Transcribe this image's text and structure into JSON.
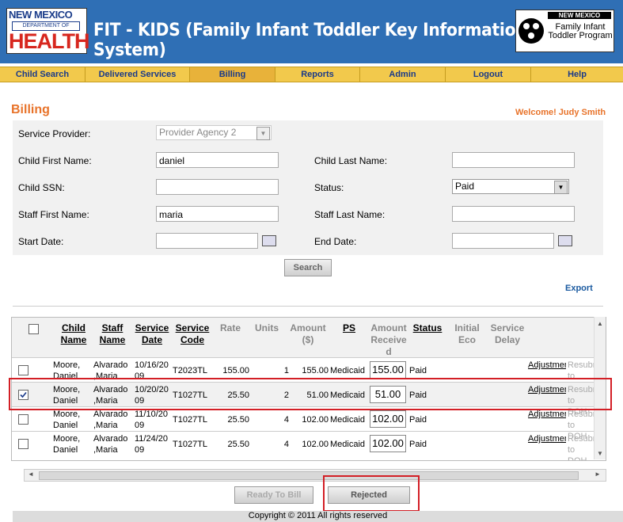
{
  "header": {
    "logo_left": {
      "line1": "NEW MEXICO",
      "line2": "DEPARTMENT OF",
      "line3": "HEALTH"
    },
    "title": "FIT - KIDS (Family Infant Toddler Key Information Data System)",
    "logo_right": {
      "line1": "NEW MEXICO",
      "line2": "Family Infant Toddler Program"
    }
  },
  "nav": [
    "Child Search",
    "Delivered Services",
    "Billing",
    "Reports",
    "Admin",
    "Logout",
    "Help"
  ],
  "page": {
    "title": "Billing",
    "welcome": "Welcome! Judy Smith"
  },
  "form": {
    "service_provider_label": "Service Provider:",
    "service_provider_value": "Provider Agency 2",
    "child_first_label": "Child First Name:",
    "child_first_value": "daniel",
    "child_last_label": "Child Last Name:",
    "child_last_value": "",
    "ssn_label": "Child SSN:",
    "ssn_value": "",
    "status_label": "Status:",
    "status_value": "Paid",
    "staff_first_label": "Staff First Name:",
    "staff_first_value": "maria",
    "staff_last_label": "Staff Last Name:",
    "staff_last_value": "",
    "start_label": "Start Date:",
    "start_value": "",
    "end_label": "End Date:",
    "end_value": "",
    "search_label": "Search"
  },
  "export_label": "Export",
  "grid": {
    "headers": [
      "Child Name",
      "Staff Name",
      "Service Date",
      "Service Code",
      "Rate",
      "Units",
      "Amount ($)",
      "PS",
      "Amount Received",
      "Status",
      "Initial Eco",
      "Service Delay"
    ],
    "rows": [
      {
        "child": "Moore, Daniel",
        "staff": "Alvarado ,Maria",
        "date": "10/16/2009",
        "code": "T2023TL",
        "rate": "155.00",
        "units": "1",
        "amount": "155.00",
        "ps": "Medicaid",
        "received": "155.00",
        "status": "Paid",
        "adj": "Adjustment",
        "resub": "Resubmit to DOH",
        "checked": false
      },
      {
        "child": "Moore, Daniel",
        "staff": "Alvarado ,Maria",
        "date": "10/20/2009",
        "code": "T1027TL",
        "rate": "25.50",
        "units": "2",
        "amount": "51.00",
        "ps": "Medicaid",
        "received": "51.00",
        "status": "Paid",
        "adj": "Adjustment",
        "resub": "Resubmit to DOH",
        "checked": true
      },
      {
        "child": "Moore, Daniel",
        "staff": "Alvarado ,Maria",
        "date": "11/10/2009",
        "code": "T1027TL",
        "rate": "25.50",
        "units": "4",
        "amount": "102.00",
        "ps": "Medicaid",
        "received": "102.00",
        "status": "Paid",
        "adj": "Adjustment",
        "resub": "Resubmit to DOH",
        "checked": false
      },
      {
        "child": "Moore, Daniel",
        "staff": "Alvarado ,Maria",
        "date": "11/24/2009",
        "code": "T1027TL",
        "rate": "25.50",
        "units": "4",
        "amount": "102.00",
        "ps": "Medicaid",
        "received": "102.00",
        "status": "Paid",
        "adj": "Adjustment",
        "resub": "Resubmit to DOH",
        "checked": false
      }
    ]
  },
  "buttons": {
    "ready": "Ready To Bill",
    "rejected": "Rejected"
  },
  "footer": "Copyright © 2011 All rights reserved"
}
